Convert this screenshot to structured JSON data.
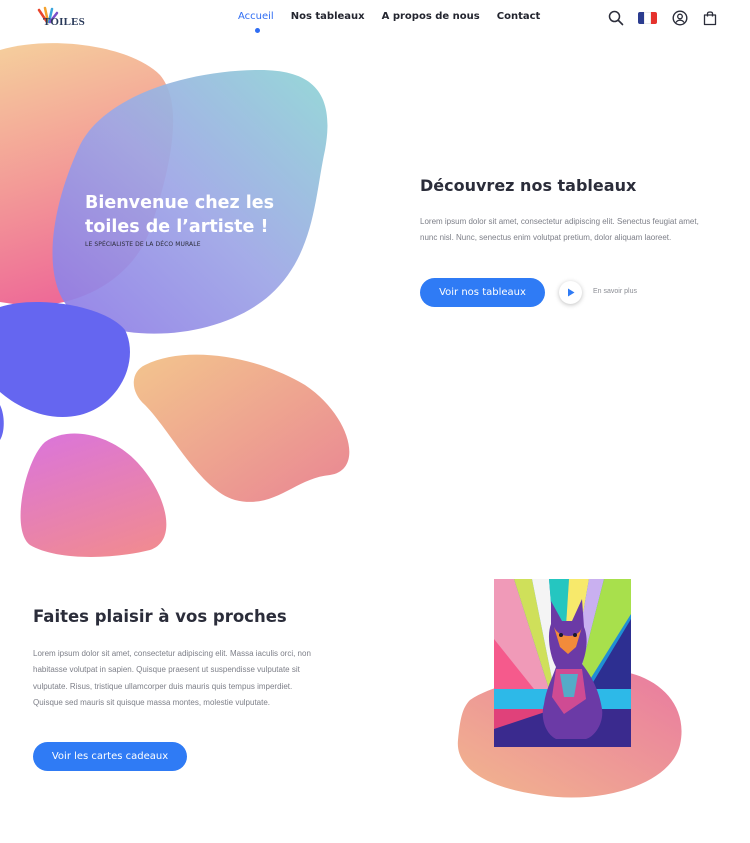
{
  "header": {
    "logo_text": "TOILES",
    "nav": [
      {
        "label": "Accueil",
        "active": true
      },
      {
        "label": "Nos tableaux"
      },
      {
        "label": "A propos de nous"
      },
      {
        "label": "Contact"
      }
    ],
    "icons": [
      "search-icon",
      "flag-fr-icon",
      "user-icon",
      "bag-icon"
    ],
    "flag_colors": [
      "#2b3c8f",
      "#ffffff",
      "#e5322d"
    ]
  },
  "hero": {
    "title": "Bienvenue chez les toiles de l’artiste !",
    "subtitle": "LE SPÉCIALISTE DE LA DÉCO MURALE"
  },
  "discover": {
    "title": "Découvrez nos tableaux",
    "text": "Lorem ipsum dolor sit amet, consectetur adipiscing elit. Senectus feugiat amet, nunc nisl. Nunc, senectus enim volutpat pretium, dolor aliquam laoreet.",
    "button": "Voir nos tableaux",
    "link": "En savoir plus"
  },
  "gifts": {
    "title": "Faites plaisir à vos proches",
    "text": "Lorem ipsum dolor sit amet, consectetur adipiscing elit. Massa iaculis orci, non habitasse volutpat in sapien. Quisque praesent ut suspendisse vulputate sit vulputate. Risus, tristique ullamcorper duis mauris quis tempus imperdiet. Quisque sed mauris sit quisque massa montes, molestie vulputate.",
    "button": "Voir les cartes cadeaux"
  },
  "colors": {
    "accent": "#2f7bf5",
    "text": "#2b2d3a"
  }
}
